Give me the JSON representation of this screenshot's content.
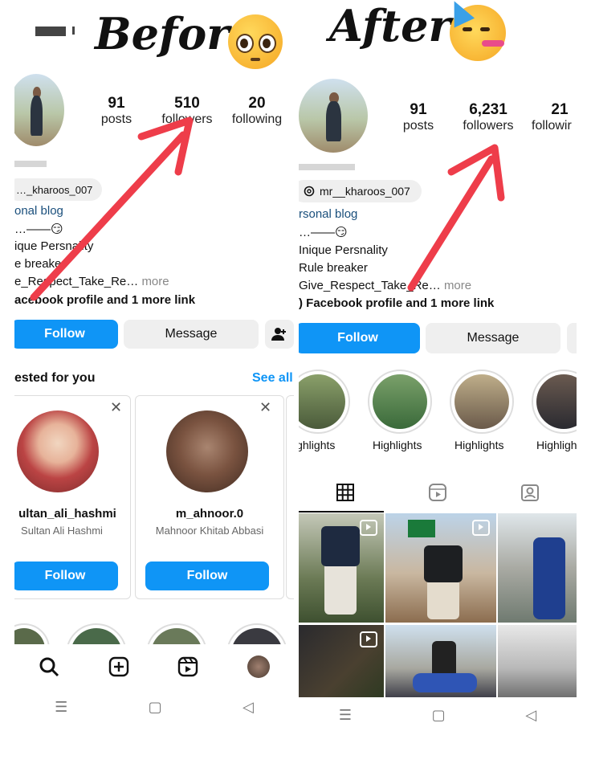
{
  "headings": {
    "before": "Before",
    "after": "After"
  },
  "before": {
    "stats": [
      {
        "value": "91",
        "label": "posts"
      },
      {
        "value": "510",
        "label": "followers"
      },
      {
        "value": "20",
        "label": "following"
      }
    ],
    "username_chip": "…_kharoos_007",
    "bio_category": "onal blog",
    "bio_lines": [
      "…——😏",
      "ique Persnality",
      "e breaker",
      "e_Respect_Take_Re…"
    ],
    "bio_more": "more",
    "bio_link": "acebook profile and 1 more link",
    "follow_label": "Follow",
    "message_label": "Message",
    "suggested_title": "ested for you",
    "see_all": "See all",
    "suggestions": [
      {
        "username": "ultan_ali_hashmi",
        "fullname": "Sultan Ali Hashmi",
        "follow": "Follow"
      },
      {
        "username": "m_ahnoor.0",
        "fullname": "Mahnoor Khitab Abbasi",
        "follow": "Follow"
      }
    ]
  },
  "after": {
    "stats": [
      {
        "value": "91",
        "label": "posts"
      },
      {
        "value": "6,231",
        "label": "followers"
      },
      {
        "value": "21",
        "label": "followir"
      }
    ],
    "username_chip": "mr__kharoos_007",
    "bio_category": "rsonal blog",
    "bio_lines": [
      "…——😏",
      "Inique Persnality",
      "Rule breaker",
      "Give_Respect_Take_Re…"
    ],
    "bio_more": "more",
    "bio_link": ") Facebook profile and 1 more link",
    "follow_label": "Follow",
    "message_label": "Message",
    "highlights": [
      "ighlights",
      "Highlights",
      "Highlights",
      "Highligh"
    ]
  },
  "colors": {
    "accent": "#0f95f6",
    "arrow": "#ee3d4a",
    "link": "#1a4f7c",
    "see_all": "#0f95f6"
  },
  "icons": {
    "before_nav": [
      "search-icon",
      "add-post-icon",
      "reels-icon",
      "profile-avatar"
    ],
    "after_tabs": [
      "grid-icon",
      "reels-tab-icon",
      "tagged-icon"
    ],
    "system_nav": [
      "menu-icon",
      "home-icon",
      "back-icon"
    ]
  }
}
